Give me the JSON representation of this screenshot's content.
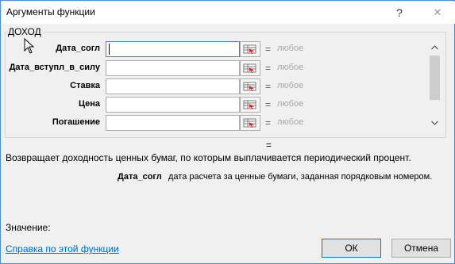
{
  "window": {
    "title": "Аргументы функции",
    "help_button": "?",
    "close_button": "✕"
  },
  "function_group": {
    "name": "ДОХОД"
  },
  "arguments": [
    {
      "label": "Дата_согл",
      "value": "",
      "equals": "=",
      "result": "любое"
    },
    {
      "label": "Дата_вступл_в_силу",
      "value": "",
      "equals": "=",
      "result": "любое"
    },
    {
      "label": "Ставка",
      "value": "",
      "equals": "=",
      "result": "любое"
    },
    {
      "label": "Цена",
      "value": "",
      "equals": "=",
      "result": "любое"
    },
    {
      "label": "Погашение",
      "value": "",
      "equals": "=",
      "result": "любое"
    }
  ],
  "result_equals": "=",
  "description": "Возвращает доходность ценных бумаг, по которым выплачивается периодический процент.",
  "argument_help": {
    "name": "Дата_согл",
    "text": "дата расчета за ценные бумаги, заданная порядковым номером."
  },
  "value_label": "Значение:",
  "help_link": "Справка по этой функции",
  "buttons": {
    "ok": "ОК",
    "cancel": "Отмена"
  },
  "icons": {
    "collapse": "range-selector-icon",
    "scroll_up": "chevron-up-icon",
    "scroll_down": "chevron-down-icon"
  }
}
